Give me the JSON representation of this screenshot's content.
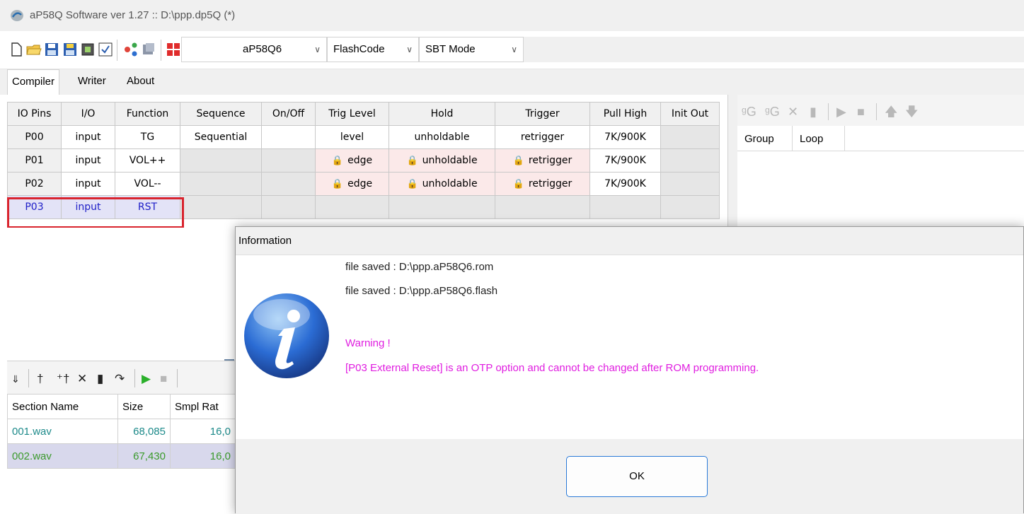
{
  "window": {
    "title": "aP58Q Software ver 1.27 :: D:\\ppp.dp5Q (*)"
  },
  "toolbar": {
    "icons": [
      "new-file-icon",
      "open-folder-icon",
      "save-icon",
      "save-as-icon",
      "chip-icon",
      "checklist-icon",
      "component-icon",
      "cube-icon",
      "grid-red-icon"
    ],
    "device_select": "aP58Q6",
    "flash_select": "FlashCode",
    "mode_select": "SBT Mode"
  },
  "tabs": [
    {
      "label": "Compiler",
      "active": true
    },
    {
      "label": "Writer",
      "active": false
    },
    {
      "label": "About",
      "active": false
    }
  ],
  "io_table": {
    "headers": [
      "IO Pins",
      "I/O",
      "Function",
      "Sequence",
      "On/Off",
      "Trig Level",
      "Hold",
      "Trigger",
      "Pull High",
      "Init Out"
    ],
    "rows": [
      {
        "pin": "P00",
        "io": "input",
        "function": "TG",
        "sequence": "Sequential",
        "onoff": "",
        "trig": "level",
        "hold": "unholdable",
        "trigger": "retrigger",
        "pull": "7K/900K",
        "init": ""
      },
      {
        "pin": "P01",
        "io": "input",
        "function": "VOL++",
        "sequence": "",
        "onoff": "",
        "trig": "edge",
        "hold": "unholdable",
        "trigger": "retrigger",
        "pull": "7K/900K",
        "init": ""
      },
      {
        "pin": "P02",
        "io": "input",
        "function": "VOL--",
        "sequence": "",
        "onoff": "",
        "trig": "edge",
        "hold": "unholdable",
        "trigger": "retrigger",
        "pull": "7K/900K",
        "init": ""
      },
      {
        "pin": "P03",
        "io": "input",
        "function": "RST",
        "sequence": "",
        "onoff": "",
        "trig": "",
        "hold": "",
        "trigger": "",
        "pull": "",
        "init": ""
      }
    ],
    "selected_row": "P03",
    "highlight_color": "#d9242e"
  },
  "right_panel": {
    "toolbar_icons": [
      "add-group-icon",
      "add-subgroup-icon",
      "delete-icon",
      "trash-icon",
      "play-icon",
      "stop-icon",
      "up-arrow-icon",
      "down-arrow-icon"
    ],
    "headers": [
      "Group",
      "Loop"
    ]
  },
  "sections": {
    "toolbar_icons": [
      "sort-az-icon",
      "add-note-icon",
      "insert-icon",
      "delete-icon",
      "trash-icon",
      "refresh-icon",
      "play-icon",
      "stop-icon"
    ],
    "headers": [
      "Section Name",
      "Size",
      "Smpl Rat"
    ],
    "rows": [
      {
        "name": "001.wav",
        "size": "68,085",
        "rate": "16,0"
      },
      {
        "name": "002.wav",
        "size": "67,430",
        "rate": "16,0"
      }
    ]
  },
  "dialog": {
    "title": "Information",
    "lines": [
      "file saved : D:\\ppp.aP58Q6.rom",
      "file saved : D:\\ppp.aP58Q6.flash"
    ],
    "warning_title": "Warning !",
    "warning_text": "[P03 External Reset] is an OTP option and cannot be changed after ROM programming.",
    "warning_color": "#e01ee0",
    "ok_label": "OK"
  }
}
